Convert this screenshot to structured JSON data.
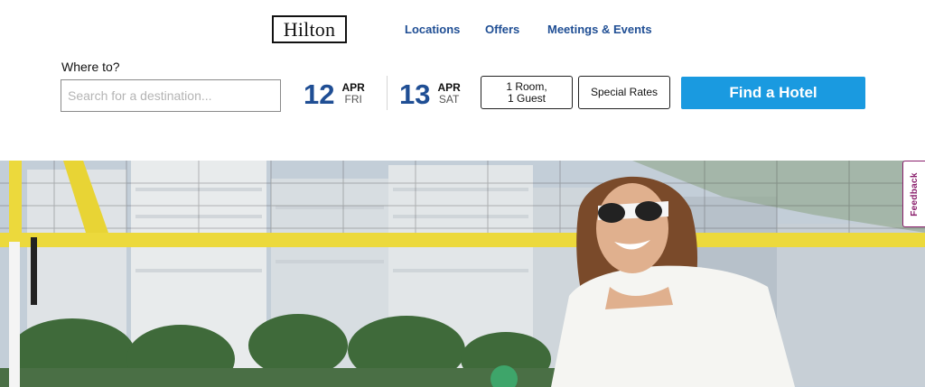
{
  "header": {
    "logo_text": "Hilton",
    "nav": [
      "Locations",
      "Offers",
      "Meetings & Events"
    ]
  },
  "search": {
    "where_label": "Where to?",
    "placeholder": "Search for a destination...",
    "checkin": {
      "day": "12",
      "month": "APR",
      "weekday": "FRI"
    },
    "checkout": {
      "day": "13",
      "month": "APR",
      "weekday": "SAT"
    },
    "rooms_line1": "1 Room,",
    "rooms_line2": "1 Guest",
    "special_rates": "Special Rates",
    "find_button": "Find a Hotel"
  },
  "feedback_tab": "Feedback",
  "colors": {
    "brand_blue": "#1f4e94",
    "button_blue": "#1a9ae0",
    "feedback_purple": "#8a1f6c",
    "net_yellow": "#f0dc3c"
  },
  "hero": {
    "image_description_icon": "beach-volleyball-photo"
  }
}
